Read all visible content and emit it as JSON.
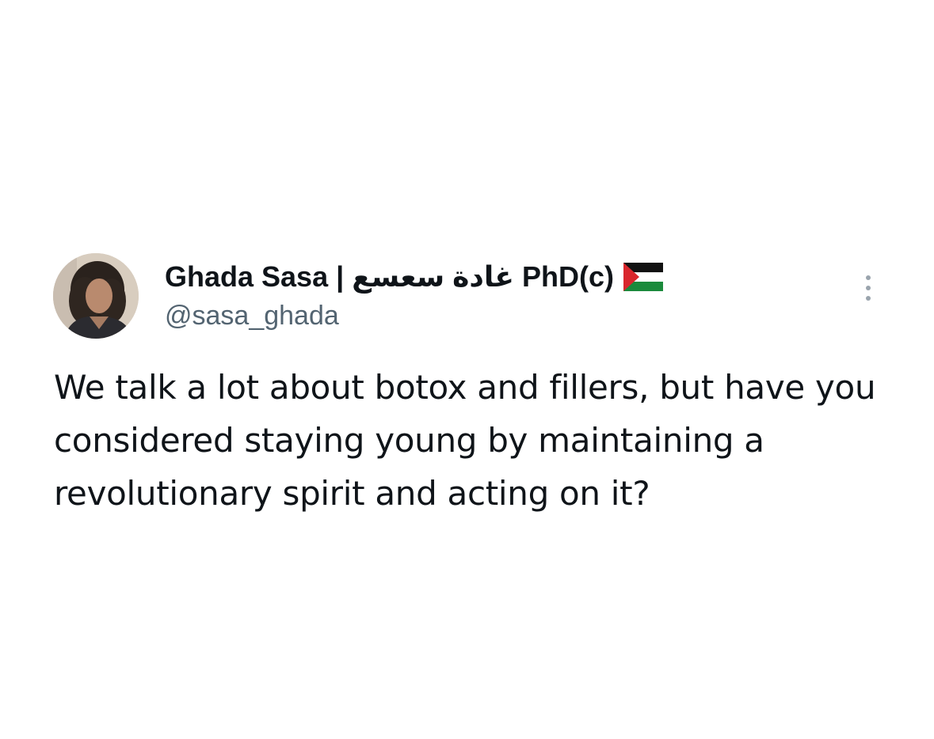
{
  "tweet": {
    "author": {
      "display_name": "Ghada Sasa | غادة سعسع PhD(c)",
      "handle": "@sasa_ghada",
      "avatar_icon": "profile-photo",
      "flag_icon": "palestine-flag-icon"
    },
    "more_icon": "more-vertical-icon",
    "text": "We talk a lot about botox and fillers, but have you considered staying young by maintaining a revolutionary spirit and acting on it?"
  }
}
